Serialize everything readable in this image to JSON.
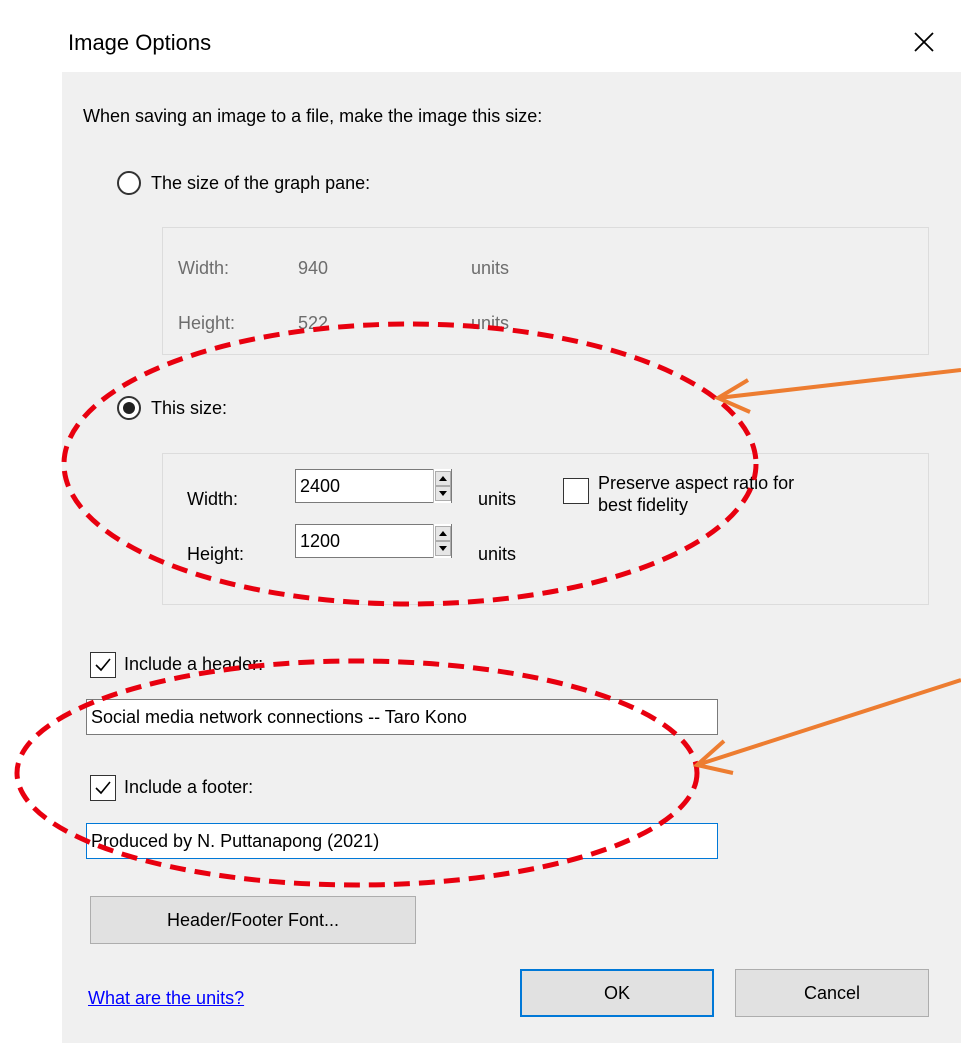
{
  "window": {
    "title": "Image Options",
    "close_icon": "close-icon"
  },
  "dialog": {
    "intro": "When saving an image to a file, make the image this size:",
    "graph_pane": {
      "radio_label": "The size of the graph pane:",
      "selected": false,
      "width_label": "Width:",
      "width_value": "940",
      "width_units": "units",
      "height_label": "Height:",
      "height_value": "522",
      "height_units": "units"
    },
    "custom_size": {
      "radio_label": "This size:",
      "selected": true,
      "width_label": "Width:",
      "width_value": "2400",
      "width_units": "units",
      "height_label": "Height:",
      "height_value": "1200",
      "height_units": "units",
      "preserve_label_line1": "Preserve aspect ratio for",
      "preserve_label_line2": "best fidelity",
      "preserve_checked": false
    },
    "header": {
      "checkbox_label": "Include a header:",
      "checked": true,
      "value": "Social media network connections -- Taro Kono"
    },
    "footer": {
      "checkbox_label": "Include a footer:",
      "checked": true,
      "value": "Produced by N. Puttanapong (2021)"
    },
    "font_button": "Header/Footer Font...",
    "help_link": "What are the units?",
    "ok_button": "OK",
    "cancel_button": "Cancel"
  },
  "annotations": {
    "ellipse_color": "#e8000f",
    "arrow_color": "#ed7d31"
  }
}
